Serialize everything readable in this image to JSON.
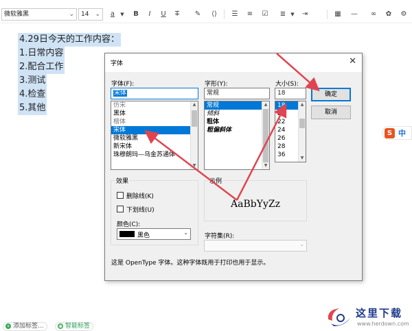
{
  "toolbar": {
    "font_name": "微软雅黑",
    "font_size": "14",
    "icons": [
      "font-color-icon",
      "bold-icon",
      "italic-icon",
      "underline-icon",
      "strikethrough-icon",
      "format-painter-icon",
      "code-icon",
      "bullet-list-icon",
      "numbered-list-icon",
      "checklist-icon",
      "align-icon",
      "table-icon",
      "divider-icon",
      "link-icon",
      "more-icon",
      "settings-icon"
    ],
    "bold": "B",
    "italic": "I",
    "underline": "U",
    "strike": "T"
  },
  "document": {
    "lines": [
      "4.29日今天的工作内容：",
      "1.日常内容",
      "2.配合工作",
      "3.测试",
      "4.检查",
      "5.其他"
    ]
  },
  "dialog": {
    "title": "字体",
    "font_label": "字体(F):",
    "font_value": "宋体",
    "font_list": [
      {
        "text": "仿宋",
        "state": "gray"
      },
      {
        "text": "黑体",
        "state": "normal"
      },
      {
        "text": "楷体",
        "state": "gray"
      },
      {
        "text": "宋体",
        "state": "selected"
      },
      {
        "text": "微软雅黑",
        "state": "normal"
      },
      {
        "text": "新宋体",
        "state": "normal"
      },
      {
        "text": "珠穆朗玛—乌金苏通体",
        "state": "normal"
      }
    ],
    "style_label": "字形(Y):",
    "style_value": "常规",
    "style_list": [
      {
        "text": "常规",
        "state": "selected"
      },
      {
        "text": "倾斜",
        "state": "italic"
      },
      {
        "text": "粗体",
        "state": "bold"
      },
      {
        "text": "粗偏斜体",
        "state": "bolditalic"
      }
    ],
    "size_label": "大小(S):",
    "size_value": "18",
    "size_list": [
      "18",
      "20",
      "22",
      "24",
      "26",
      "28",
      "36"
    ],
    "ok": "确定",
    "cancel": "取消",
    "effects_title": "效果",
    "strikethrough": "删除线(K)",
    "underline": "下划线(U)",
    "color_label": "颜色(C):",
    "color_value": "黑色",
    "color_swatch": "#000000",
    "sample_title": "示例",
    "sample_text": "AaBbYyZz",
    "charset_label": "字符集(R):",
    "note": "这是 OpenType 字体。这种字体既用于打印也用于显示。"
  },
  "footer": {
    "add_tag": "添加标签...",
    "smart_tag": "智能标签"
  },
  "ime": {
    "logo": "S",
    "mode": "中"
  },
  "watermark": {
    "title": "这里下载",
    "url": "www.herdown.com"
  },
  "colors": {
    "accent": "#0078d7",
    "selection": "#cfe3f5",
    "arrow": "#e0454f"
  }
}
